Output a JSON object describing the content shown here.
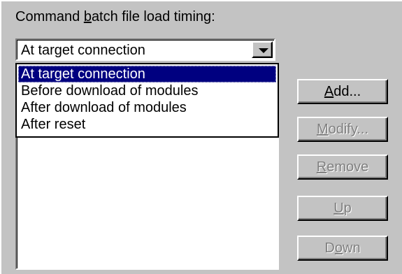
{
  "label": {
    "prefix": "Command ",
    "mnemonic": "b",
    "suffix": "atch file load timing:"
  },
  "combo": {
    "selected": "At target connection"
  },
  "dropdown": {
    "options": [
      "At target connection",
      "Before download of modules",
      "After download of modules",
      "After reset"
    ],
    "selected_index": 0
  },
  "buttons": {
    "add": {
      "mnemonic": "A",
      "rest": "dd...",
      "enabled": true
    },
    "modify": {
      "mnemonic": "M",
      "rest": "odify...",
      "enabled": false
    },
    "remove": {
      "mnemonic": "R",
      "rest": "emove",
      "enabled": false
    },
    "up": {
      "mnemonic": "U",
      "rest": "p",
      "enabled": false
    },
    "down": {
      "before": "D",
      "mnemonic": "o",
      "rest": "wn",
      "enabled": false
    }
  }
}
